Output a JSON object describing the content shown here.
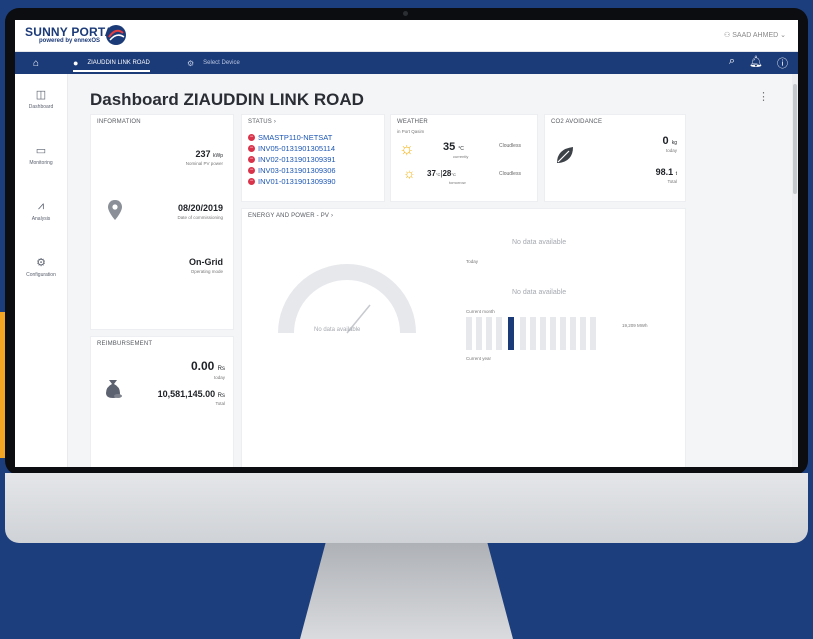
{
  "app": {
    "logo_text": "SUNNY PORTAL",
    "logo_sub": "powered by ennexOS",
    "user": "SAAD AHMED"
  },
  "navbar": {
    "plant_name": "ZIAUDDIN LINK ROAD",
    "select_device": "Select Device"
  },
  "sidebar": {
    "items": [
      {
        "label": "Dashboard",
        "icon": "dashboard-icon"
      },
      {
        "label": "Monitoring",
        "icon": "monitor-icon"
      },
      {
        "label": "Analysis",
        "icon": "chart-icon"
      },
      {
        "label": "Configuration",
        "icon": "gear-icon"
      }
    ]
  },
  "dashboard": {
    "title": "Dashboard ZIAUDDIN LINK ROAD",
    "information": {
      "title": "INFORMATION",
      "power_value": "237",
      "power_unit": "kWp",
      "power_label": "Nominal PV power",
      "date_value": "08/20/2019",
      "date_label": "Date of commissioning",
      "mode_value": "On-Grid",
      "mode_label": "Operating mode"
    },
    "status": {
      "title": "STATUS",
      "devices": [
        "SMASTP110-NETSAT",
        "INV05-0131901305114",
        "INV02-0131901309391",
        "INV03-0131901309306",
        "INV01-0131901309390"
      ]
    },
    "weather": {
      "title": "WEATHER",
      "location": "in Port Qasim",
      "current_temp": "35",
      "current_unit": "°C",
      "current_label": "currently",
      "current_cond": "Cloudless",
      "forecast_temp": "37",
      "forecast_temp2": "28",
      "forecast_unit": "°C",
      "forecast_label": "tomorrow",
      "forecast_cond": "Cloudless"
    },
    "co2": {
      "title": "CO2 AVOIDANCE",
      "today_value": "0",
      "today_unit": "kg",
      "today_label": "today",
      "total_value": "98.1",
      "total_unit": "t",
      "total_label": "Total"
    },
    "energy": {
      "title": "ENERGY AND POWER - PV",
      "no_data": "No data available",
      "today_label": "Today",
      "current_month_label": "Current month",
      "current_year_label": "Current year",
      "bar_value_label": "19,209 MWh"
    },
    "reimbursement": {
      "title": "REIMBURSEMENT",
      "today_value": "0.00",
      "today_unit": "Rs",
      "today_label": "today",
      "total_value": "10,581,145.00",
      "total_unit": "Rs",
      "total_label": "Total"
    }
  },
  "colors": {
    "background": "#1d3e7d",
    "navbar": "#1b3a78",
    "accent": "#f5a623",
    "status_error": "#d9334b",
    "link": "#1b56b5",
    "bar_active": "#1b3a78"
  }
}
